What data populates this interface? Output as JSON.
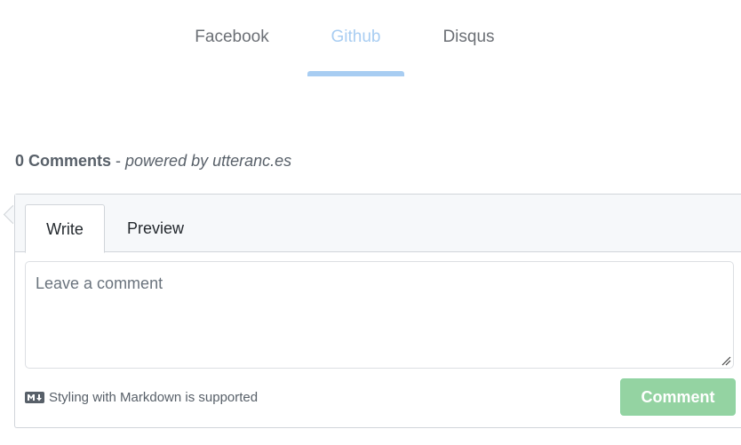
{
  "source_tabs": [
    {
      "label": "Facebook",
      "active": false
    },
    {
      "label": "Github",
      "active": true
    },
    {
      "label": "Disqus",
      "active": false
    }
  ],
  "comments": {
    "count_label": "0 Comments",
    "separator": " - ",
    "powered_by": "powered by utteranc.es"
  },
  "editor": {
    "tabs": [
      {
        "label": "Write",
        "selected": true
      },
      {
        "label": "Preview",
        "selected": false
      }
    ],
    "textarea": {
      "value": "",
      "placeholder": "Leave a comment"
    },
    "markdown_note": "Styling with Markdown is supported",
    "markdown_icon": "markdown-icon",
    "submit_label": "Comment"
  },
  "colors": {
    "active_tab": "#a8cdf2",
    "submit_button": "#94d3a2",
    "muted_text": "#586069"
  }
}
